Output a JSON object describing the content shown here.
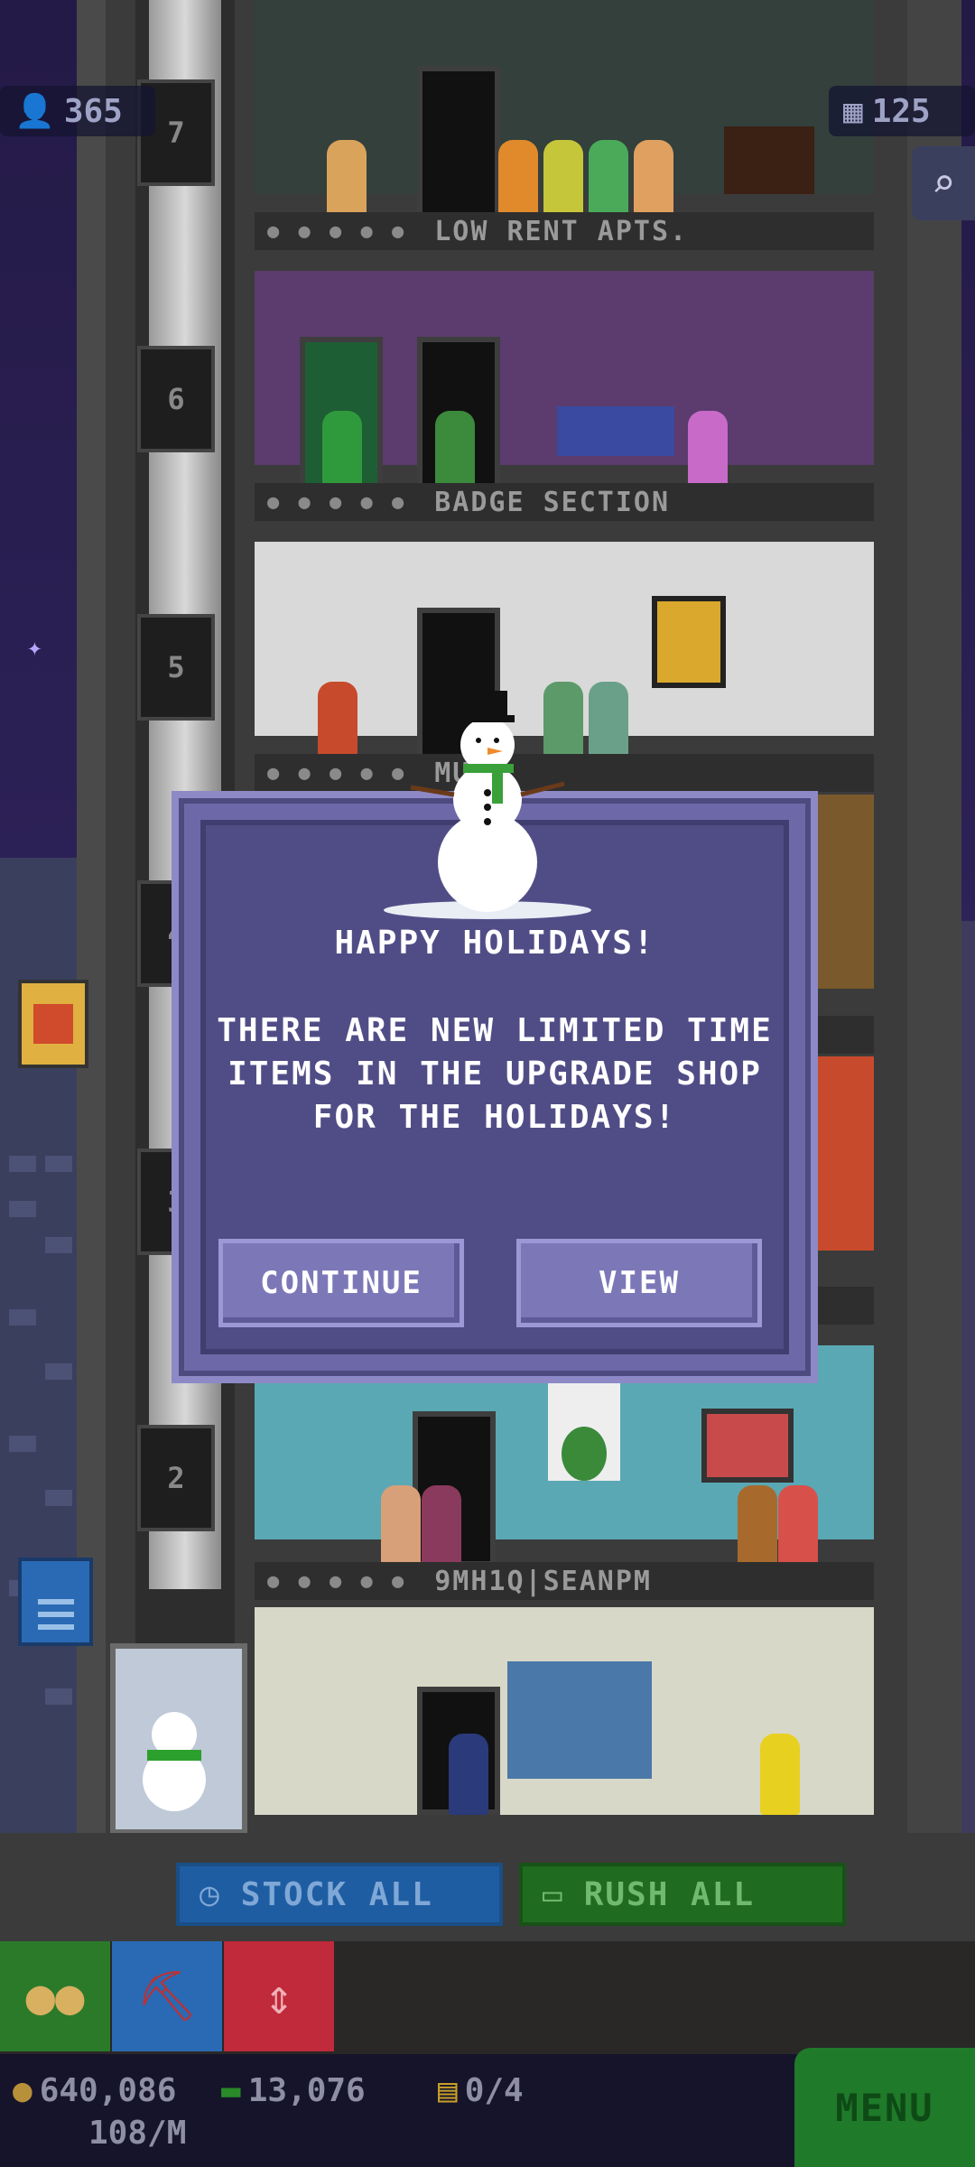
{
  "top_stats": {
    "population": "365",
    "floors": "125"
  },
  "floors": [
    {
      "number": "7",
      "label": "LOW RENT APTS."
    },
    {
      "number": "6",
      "label": "BADGE SECTION"
    },
    {
      "number": "5",
      "label": "MU"
    },
    {
      "number": "4",
      "label": ""
    },
    {
      "number": "3",
      "label": ""
    },
    {
      "number": "2",
      "label": "9MH1Q|SEANPM"
    }
  ],
  "modal": {
    "title": "HAPPY HOLIDAYS!",
    "body": "THERE ARE NEW LIMITED TIME ITEMS IN THE UPGRADE SHOP FOR THE HOLIDAYS!",
    "continue_label": "CONTINUE",
    "view_label": "VIEW"
  },
  "actions": {
    "stock_all": "STOCK ALL",
    "rush_all": "RUSH ALL"
  },
  "status": {
    "coins": "640,086",
    "bux": "13,076",
    "tickets": "0/4",
    "rate": "108/M"
  },
  "menu_label": "MENU",
  "colors": {
    "modal_bg": "#504d86",
    "modal_border": "#6d69a8",
    "stock_blue": "#1f5da3",
    "rush_green": "#1f6b1f",
    "menu_green": "#1f7a2a"
  },
  "icons": [
    "population-icon",
    "floors-icon",
    "search-icon",
    "clock-icon",
    "cash-icon",
    "coins-icon",
    "pickaxe-icon",
    "elevator-icon",
    "coin-icon",
    "bux-icon",
    "ticket-icon"
  ]
}
